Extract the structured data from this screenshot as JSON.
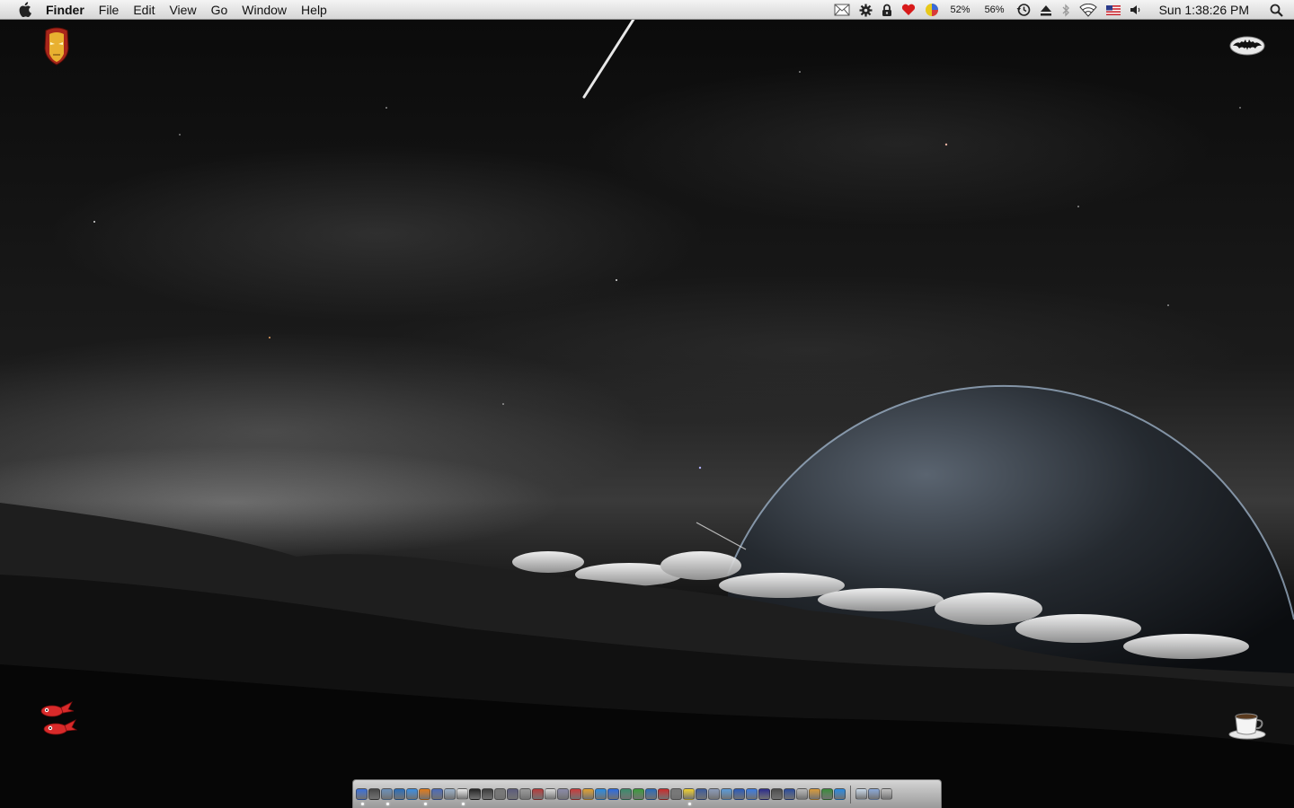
{
  "menubar": {
    "app_name": "Finder",
    "menus": [
      "File",
      "Edit",
      "View",
      "Go",
      "Window",
      "Help"
    ],
    "status": {
      "cpu_percent": "52%",
      "mem_percent": "56%",
      "clock": "Sun 1:38:26 PM"
    }
  },
  "status_icons": [
    "mail-icon",
    "gear-icon",
    "lock-icon",
    "heart-icon",
    "color-wheel-icon",
    "time-machine-icon",
    "eject-icon",
    "bluetooth-icon",
    "wifi-icon",
    "us-flag-icon",
    "volume-icon",
    "spotlight-icon"
  ],
  "desktop_icons": [
    "iron-man-icon",
    "batman-icon",
    "crab-icon",
    "coffee-cup-icon"
  ],
  "dock": {
    "apps": [
      {
        "icon": "finder-icon",
        "color": "#3a6fd8",
        "running": true
      },
      {
        "icon": "dashboard-icon",
        "color": "#444",
        "running": false
      },
      {
        "icon": "mail-app-icon",
        "color": "#6a8fb8",
        "running": true
      },
      {
        "icon": "safari-icon",
        "color": "#2a6db8",
        "running": false
      },
      {
        "icon": "ichat-icon",
        "color": "#3a8de0",
        "running": false
      },
      {
        "icon": "firefox-icon",
        "color": "#e07a1a",
        "running": true
      },
      {
        "icon": "itunes-icon",
        "color": "#4a6ab8",
        "running": false
      },
      {
        "icon": "preview-icon",
        "color": "#9ab0c8",
        "running": false
      },
      {
        "icon": "textedit-icon",
        "color": "#e8e8e8",
        "running": true
      },
      {
        "icon": "terminal-icon",
        "color": "#222",
        "running": false
      },
      {
        "icon": "activity-monitor-icon",
        "color": "#3a3a3a",
        "running": false
      },
      {
        "icon": "system-preferences-icon",
        "color": "#777",
        "running": false
      },
      {
        "icon": "x11-icon",
        "color": "#5a5a7a",
        "running": false
      },
      {
        "icon": "utilities-icon",
        "color": "#999",
        "running": false
      },
      {
        "icon": "photo-booth-icon",
        "color": "#b43a3a",
        "running": false
      },
      {
        "icon": "script-editor-icon",
        "color": "#d8d8d8",
        "running": false
      },
      {
        "icon": "pen-icon",
        "color": "#8a8aa8",
        "running": false
      },
      {
        "icon": "calendar-icon",
        "color": "#c83a3a",
        "running": false
      },
      {
        "icon": "feather-icon",
        "color": "#e0a030",
        "running": false
      },
      {
        "icon": "quicktime-icon",
        "color": "#2a8ae0",
        "running": false
      },
      {
        "icon": "dropbox-icon",
        "color": "#2a6ae0",
        "running": false
      },
      {
        "icon": "camino-icon",
        "color": "#3a8a6a",
        "running": false
      },
      {
        "icon": "ftp-icon",
        "color": "#3a9a3a",
        "running": false
      },
      {
        "icon": "vlc-icon",
        "color": "#2a6ab8",
        "running": false
      },
      {
        "icon": "acrobat-icon",
        "color": "#c82a2a",
        "running": false
      },
      {
        "icon": "key-icon",
        "color": "#777",
        "running": false
      },
      {
        "icon": "notes-icon",
        "color": "#f0d030",
        "running": true
      },
      {
        "icon": "photoshop-icon",
        "color": "#3a5a9a",
        "running": false
      },
      {
        "icon": "monitor-icon",
        "color": "#8a9ab8",
        "running": false
      },
      {
        "icon": "photos-icon",
        "color": "#5a9ad8",
        "running": false
      },
      {
        "icon": "globe-icon",
        "color": "#2a5ab8",
        "running": false
      },
      {
        "icon": "network-icon",
        "color": "#3a7ae0",
        "running": false
      },
      {
        "icon": "spaces-icon",
        "color": "#2a2a8a",
        "running": false
      },
      {
        "icon": "xcode-icon",
        "color": "#4a4a4a",
        "running": false
      },
      {
        "icon": "disk-utility-icon",
        "color": "#2a4a9a",
        "running": false
      },
      {
        "icon": "app-store-icon",
        "color": "#b8b8b8",
        "running": false
      },
      {
        "icon": "growl-icon",
        "color": "#d89a3a",
        "running": false
      },
      {
        "icon": "chrome-icon",
        "color": "#3a8a3a",
        "running": false
      },
      {
        "icon": "skype-icon",
        "color": "#2a8ae0",
        "running": false
      }
    ],
    "stacks": [
      {
        "icon": "document-stack-icon",
        "color": "#c8d8e8"
      },
      {
        "icon": "folder-stack-icon",
        "color": "#8aa8d8"
      },
      {
        "icon": "trash-icon",
        "color": "#c0c0c0"
      }
    ]
  }
}
